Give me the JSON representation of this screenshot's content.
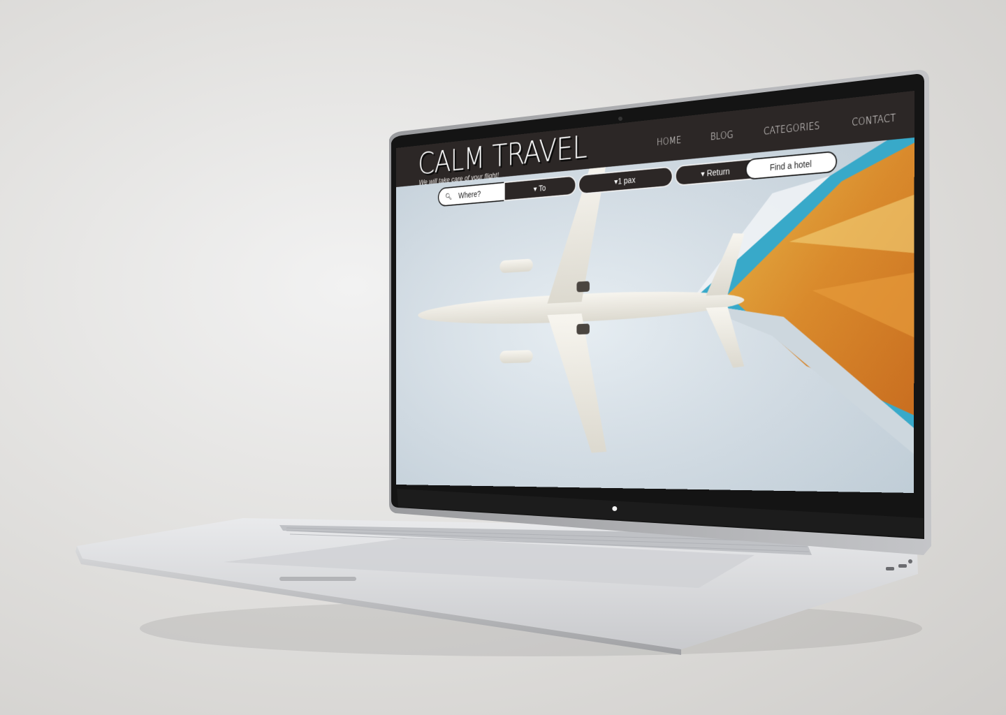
{
  "site": {
    "logo": "CALM TRAVEL",
    "tagline": "We will take care of your flight!"
  },
  "nav": {
    "items": [
      {
        "label": "HOME"
      },
      {
        "label": "BLOG"
      },
      {
        "label": "CATEGORIES"
      },
      {
        "label": "CONTACT"
      }
    ]
  },
  "search": {
    "where_placeholder": "Where?",
    "to_label": "▾ To",
    "pax_label": "▾1 pax",
    "return_label": "▾ Return",
    "hotel_button": "Find a hotel",
    "search_icon": "search-icon"
  },
  "colors": {
    "header_bg": "#2c2726",
    "hero_bg": "#d7e1e8"
  }
}
